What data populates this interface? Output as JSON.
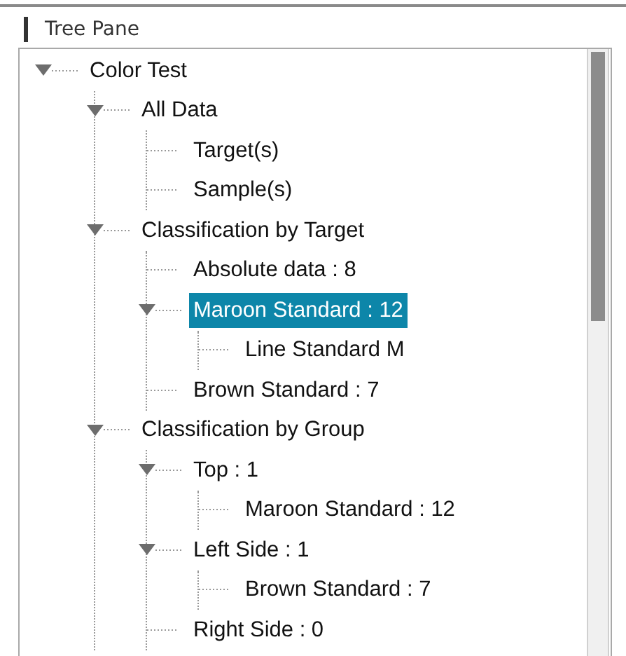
{
  "pane": {
    "title": "Tree Pane"
  },
  "tree": [
    {
      "label": "Color Test",
      "expanded": true,
      "selected": false,
      "children": [
        {
          "label": "All Data",
          "expanded": true,
          "selected": false,
          "children": [
            {
              "label": "Target(s)",
              "selected": false
            },
            {
              "label": "Sample(s)",
              "selected": false
            }
          ]
        },
        {
          "label": "Classification by Target",
          "expanded": true,
          "selected": false,
          "children": [
            {
              "label": "Absolute data : 8",
              "selected": false
            },
            {
              "label": "Maroon Standard : 12",
              "expanded": true,
              "selected": true,
              "children": [
                {
                  "label": "Line Standard M",
                  "selected": false
                }
              ]
            },
            {
              "label": "Brown Standard : 7",
              "selected": false
            }
          ]
        },
        {
          "label": "Classification by Group",
          "expanded": true,
          "selected": false,
          "children": [
            {
              "label": "Top : 1",
              "expanded": true,
              "selected": false,
              "children": [
                {
                  "label": "Maroon Standard : 12",
                  "selected": false
                }
              ]
            },
            {
              "label": "Left Side : 1",
              "expanded": true,
              "selected": false,
              "children": [
                {
                  "label": "Brown Standard : 7",
                  "selected": false
                }
              ]
            },
            {
              "label": "Right Side : 0",
              "selected": false
            }
          ]
        }
      ]
    }
  ]
}
